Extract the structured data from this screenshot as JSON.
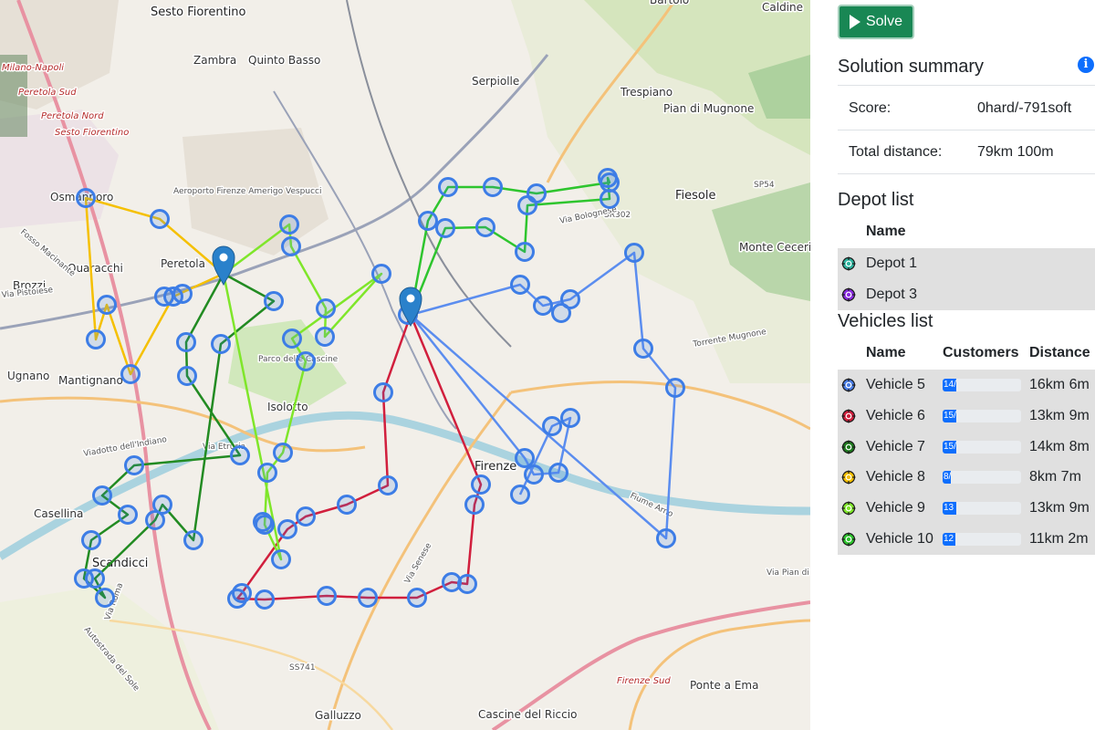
{
  "map": {
    "place_labels": [
      {
        "text": "Sesto Fiorentino",
        "cls": "big"
      },
      {
        "text": "Zambra",
        "cls": ""
      },
      {
        "text": "Quinto Basso",
        "cls": ""
      },
      {
        "text": "Serpiolle",
        "cls": ""
      },
      {
        "text": "Trespiano",
        "cls": ""
      },
      {
        "text": "Pian di Mugnone",
        "cls": ""
      },
      {
        "text": "Fiesole",
        "cls": "big"
      },
      {
        "text": "Osmannoro",
        "cls": ""
      },
      {
        "text": "Peretola",
        "cls": ""
      },
      {
        "text": "Quaracchi",
        "cls": ""
      },
      {
        "text": "Brozzi",
        "cls": ""
      },
      {
        "text": "Ugnano",
        "cls": ""
      },
      {
        "text": "Mantignano",
        "cls": ""
      },
      {
        "text": "Isolotto",
        "cls": ""
      },
      {
        "text": "Firenze",
        "cls": "big"
      },
      {
        "text": "Casellina",
        "cls": ""
      },
      {
        "text": "Scandicci",
        "cls": "big"
      },
      {
        "text": "Galluzzo",
        "cls": ""
      },
      {
        "text": "Cascine del Riccio",
        "cls": ""
      },
      {
        "text": "Ponte a Ema",
        "cls": ""
      },
      {
        "text": "Monte Ceceri",
        "cls": ""
      },
      {
        "text": "Caldine",
        "cls": ""
      },
      {
        "text": "Bartolo",
        "cls": ""
      },
      {
        "text": "Aeroporto Firenze Amerigo Vespucci",
        "cls": "road"
      },
      {
        "text": "SR302",
        "cls": "road"
      },
      {
        "text": "SP54",
        "cls": "road"
      },
      {
        "text": "SS741",
        "cls": "road"
      },
      {
        "text": "Milano-Napoli",
        "cls": "red"
      },
      {
        "text": "Peretola Sud",
        "cls": "red"
      },
      {
        "text": "Peretola Nord",
        "cls": "red"
      },
      {
        "text": "Sesto Fiorentino",
        "cls": "red"
      },
      {
        "text": "Firenze Sud",
        "cls": "red"
      },
      {
        "text": "Via Pistoiese",
        "cls": "road"
      },
      {
        "text": "Via Etruria",
        "cls": "road"
      },
      {
        "text": "Viadotto dell'Indiano",
        "cls": "road"
      },
      {
        "text": "Via Roma",
        "cls": "road"
      },
      {
        "text": "Via Senese",
        "cls": "road"
      },
      {
        "text": "Via Bolognese",
        "cls": "road"
      },
      {
        "text": "Torrente Mugnone",
        "cls": "road"
      },
      {
        "text": "Fiume Arno",
        "cls": "road"
      },
      {
        "text": "Fosso Macinante",
        "cls": "road"
      },
      {
        "text": "Parco delle Cascine",
        "cls": "road"
      },
      {
        "text": "Autostrada del Sole",
        "cls": "road"
      },
      {
        "text": "Via Pian di Ripoli",
        "cls": "road"
      }
    ],
    "depots": [
      {
        "name": "Depot 1"
      },
      {
        "name": "Depot 3"
      }
    ],
    "routes": [
      {
        "vehicle": "Vehicle 5",
        "color": "#5b8def"
      },
      {
        "vehicle": "Vehicle 6",
        "color": "#d11f3d"
      },
      {
        "vehicle": "Vehicle 7",
        "color": "#228b22"
      },
      {
        "vehicle": "Vehicle 8",
        "color": "#f5c000"
      },
      {
        "vehicle": "Vehicle 9",
        "color": "#7fe62a"
      },
      {
        "vehicle": "Vehicle 10",
        "color": "#2ec52e"
      }
    ],
    "customer_marker_color": "#3d7de6"
  },
  "solve_label": "Solve",
  "summary": {
    "title": "Solution summary",
    "score_label": "Score:",
    "score_value": "0hard/-791soft",
    "distance_label": "Total distance:",
    "distance_value": "79km 100m"
  },
  "depot_list": {
    "title": "Depot list",
    "name_header": "Name",
    "rows": [
      {
        "name": "Depot 1",
        "color": "#2fb5a0"
      },
      {
        "name": "Depot 3",
        "color": "#8a2be2"
      }
    ]
  },
  "vehicle_list": {
    "title": "Vehicles list",
    "headers": {
      "name": "Name",
      "customers": "Customers",
      "distance": "Distance"
    },
    "rows": [
      {
        "name": "Vehicle 5",
        "color": "#4a7ee6",
        "customers": "14/",
        "fill": 0.18,
        "distance": "16km 6m"
      },
      {
        "name": "Vehicle 6",
        "color": "#d11f3d",
        "customers": "15/",
        "fill": 0.18,
        "distance": "13km 9m"
      },
      {
        "name": "Vehicle 7",
        "color": "#1e7b1e",
        "customers": "15/",
        "fill": 0.18,
        "distance": "14km 8m"
      },
      {
        "name": "Vehicle 8",
        "color": "#f5c000",
        "customers": "8/",
        "fill": 0.1,
        "distance": "8km 7m"
      },
      {
        "name": "Vehicle 9",
        "color": "#7fe62a",
        "customers": "13",
        "fill": 0.17,
        "distance": "13km 9m"
      },
      {
        "name": "Vehicle 10",
        "color": "#2ec52e",
        "customers": "12",
        "fill": 0.16,
        "distance": "11km 2m"
      }
    ]
  }
}
